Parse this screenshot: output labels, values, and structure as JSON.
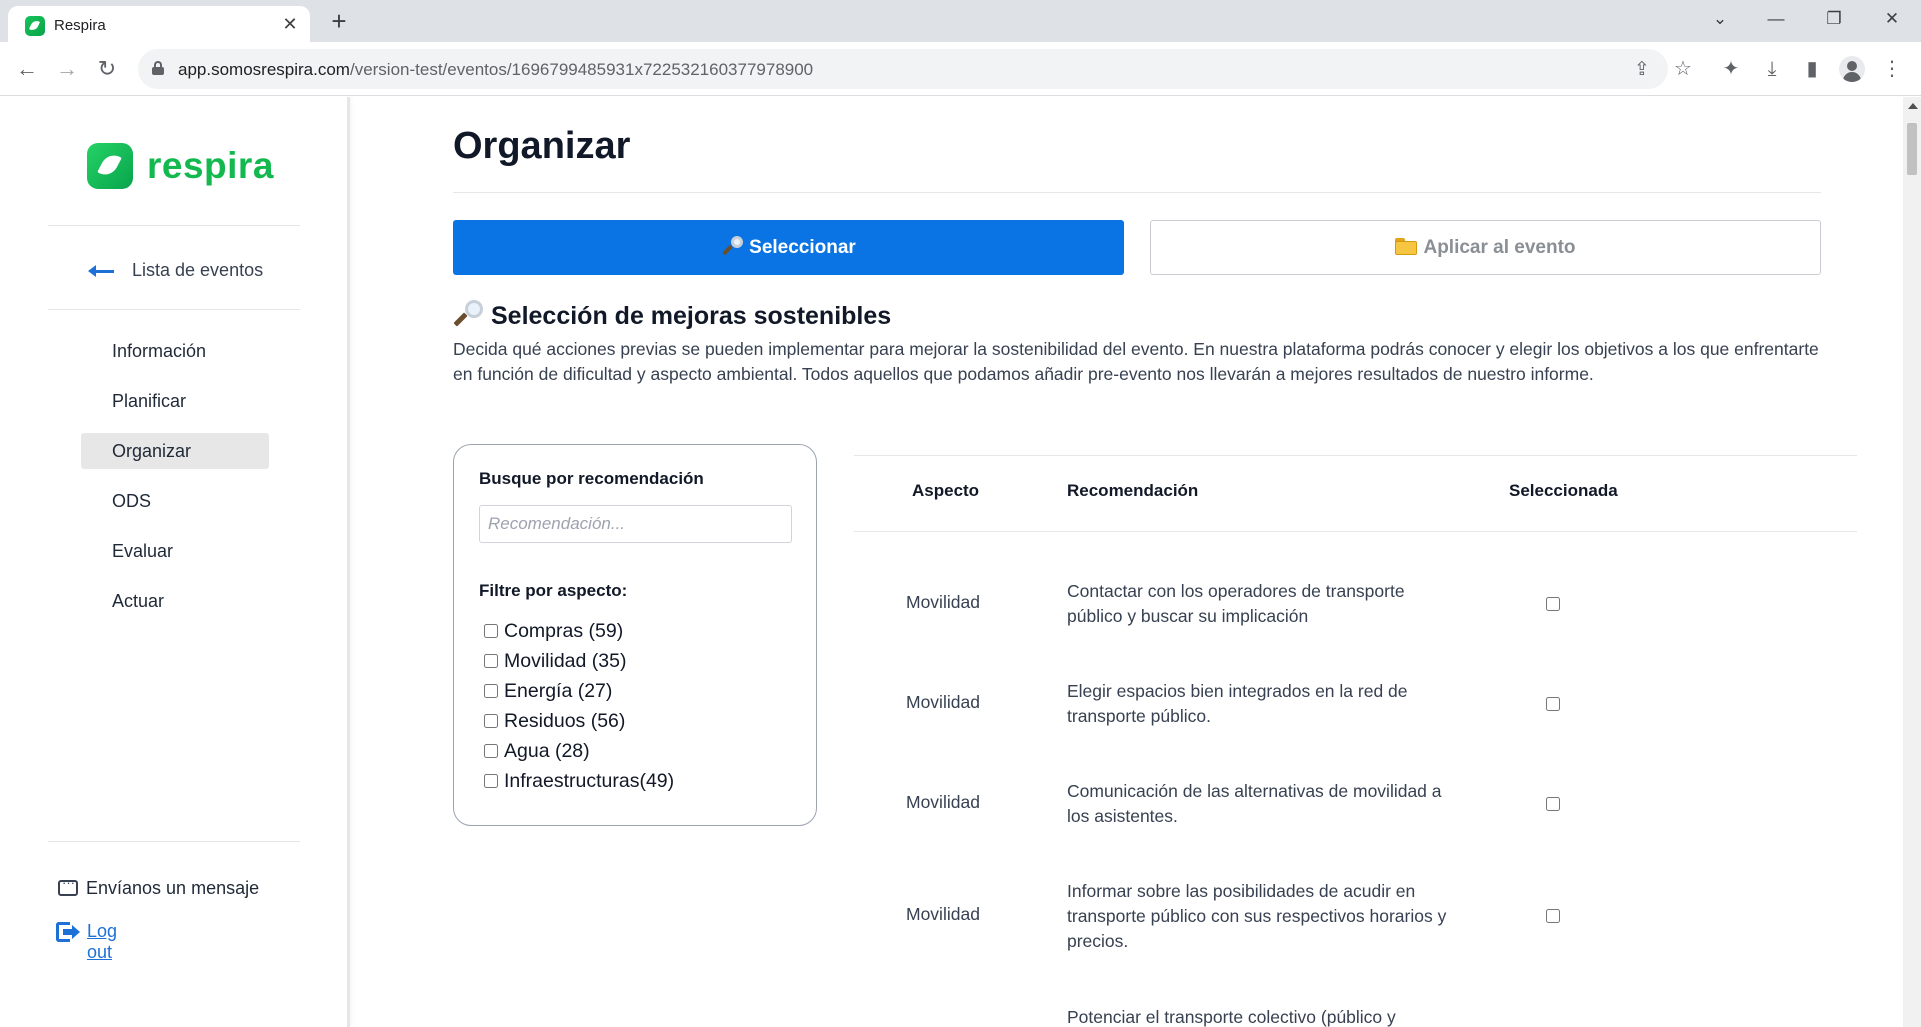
{
  "browser": {
    "tab_title": "Respira",
    "url_host": "app.somosrespira.com",
    "url_path": "/version-test/eventos/1696799485931x722532160377978900",
    "icons": [
      "back-icon",
      "forward-icon",
      "reload-icon",
      "lock-icon",
      "share-icon",
      "star-icon",
      "extensions-icon",
      "download-icon",
      "sidebar-icon",
      "profile-icon",
      "menu-icon"
    ]
  },
  "sidebar": {
    "logo_text": "respira",
    "back_label": "Lista de eventos",
    "nav_items": [
      {
        "label": "Información",
        "active": false
      },
      {
        "label": "Planificar",
        "active": false
      },
      {
        "label": "Organizar",
        "active": true
      },
      {
        "label": "ODS",
        "active": false
      },
      {
        "label": "Evaluar",
        "active": false
      },
      {
        "label": "Actuar",
        "active": false
      }
    ],
    "message_label": "Envíanos un mensaje",
    "logout_label": "Log out"
  },
  "main": {
    "title": "Organizar",
    "tabs": [
      {
        "label": "Seleccionar",
        "icon": "magnifier-icon",
        "active": true
      },
      {
        "label": "Aplicar al evento",
        "icon": "folder-icon",
        "active": false
      }
    ],
    "section": {
      "heading": "Selección de mejoras sostenibles",
      "description": "Decida qué acciones previas se pueden implementar para mejorar la sostenibilidad del evento. En nuestra plataforma podrás conocer y elegir los objetivos a los que enfrentarte en función de dificultad y aspecto ambiental. Todos aquellos que podamos añadir pre-evento nos llevarán a mejores resultados de nuestro informe."
    },
    "filters": {
      "search_label": "Busque por recomendación",
      "search_placeholder": "Recomendación...",
      "search_value": "",
      "aspect_label": "Filtre por aspecto:",
      "aspects": [
        {
          "label": "Compras (59)",
          "checked": false
        },
        {
          "label": "Movilidad (35)",
          "checked": false
        },
        {
          "label": "Energía (27)",
          "checked": false
        },
        {
          "label": "Residuos (56)",
          "checked": false
        },
        {
          "label": "Agua (28)",
          "checked": false
        },
        {
          "label": "Infraestructuras(49)",
          "checked": false
        }
      ]
    },
    "table": {
      "headers": [
        "Aspecto",
        "Recomendación",
        "Seleccionada"
      ],
      "rows": [
        {
          "aspect": "Movilidad",
          "recommendation": "Contactar con los operadores de transporte público y buscar su implicación",
          "selected": false
        },
        {
          "aspect": "Movilidad",
          "recommendation": "Elegir espacios bien integrados en la red de transporte público.",
          "selected": false
        },
        {
          "aspect": "Movilidad",
          "recommendation": "Comunicación de las alternativas de movilidad a los asistentes.",
          "selected": false
        },
        {
          "aspect": "Movilidad",
          "recommendation": "Informar sobre las posibilidades de acudir en transporte público con sus respectivos horarios y precios.",
          "selected": false
        },
        {
          "aspect": "",
          "recommendation": "Potenciar el transporte colectivo (público y",
          "selected": false
        }
      ]
    }
  },
  "colors": {
    "brand_green": "#13b94f",
    "primary_blue": "#0b74e5",
    "link_blue": "#1d70d6"
  }
}
